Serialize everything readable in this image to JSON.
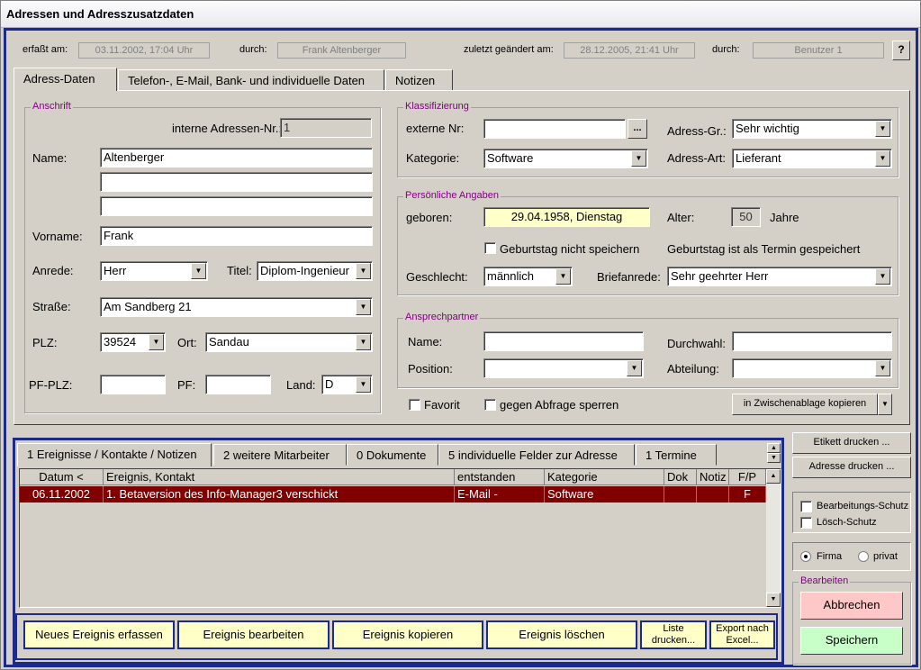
{
  "window_title": "Adressen und Adresszusatzdaten",
  "meta": {
    "erfasst_label": "erfaßt am:",
    "erfasst_value": "03.11.2002, 17:04 Uhr",
    "durch1_label": "durch:",
    "durch1_value": "Frank Altenberger",
    "geaendert_label": "zuletzt geändert am:",
    "geaendert_value": "28.12.2005, 21:41 Uhr",
    "durch2_label": "durch:",
    "durch2_value": "Benutzer 1",
    "help_icon": "help-icon"
  },
  "tabs": [
    "Adress-Daten",
    "Telefon-, E-Mail, Bank- und individuelle Daten",
    "Notizen"
  ],
  "anschrift": {
    "title": "Anschrift",
    "intnr_label": "interne Adressen-Nr.:",
    "intnr_value": "1",
    "name_label": "Name:",
    "name1": "Altenberger",
    "name2": "",
    "name3": "",
    "vorname_label": "Vorname:",
    "vorname": "Frank",
    "anrede_label": "Anrede:",
    "anrede": "Herr",
    "titel_label": "Titel:",
    "titel": "Diplom-Ingenieur",
    "strasse_label": "Straße:",
    "strasse": "Am Sandberg 21",
    "plz_label": "PLZ:",
    "plz": "39524",
    "ort_label": "Ort:",
    "ort": "Sandau",
    "pfplz_label": "PF-PLZ:",
    "pfplz": "",
    "pf_label": "PF:",
    "pf": "",
    "land_label": "Land:",
    "land": "D"
  },
  "klassifizierung": {
    "title": "Klassifizierung",
    "extnr_label": "externe Nr:",
    "extnr": "",
    "ellipsis": "...",
    "adressgr_label": "Adress-Gr.:",
    "adressgr": "Sehr wichtig",
    "kategorie_label": "Kategorie:",
    "kategorie": "Software",
    "adressart_label": "Adress-Art:",
    "adressart": "Lieferant"
  },
  "persoenlich": {
    "title": "Persönliche Angaben",
    "geboren_label": "geboren:",
    "geboren": "29.04.1958, Dienstag",
    "alter_label": "Alter:",
    "alter": "50",
    "jahre": "Jahre",
    "geb_nicht_speichern": "Geburtstag nicht speichern",
    "geb_termin": "Geburtstag ist als Termin gespeichert",
    "geschlecht_label": "Geschlecht:",
    "geschlecht": "männlich",
    "briefanrede_label": "Briefanrede:",
    "briefanrede": "Sehr geehrter Herr"
  },
  "ansprechpartner": {
    "title": "Ansprechpartner",
    "name_label": "Name:",
    "name": "",
    "durchwahl_label": "Durchwahl:",
    "durchwahl": "",
    "position_label": "Position:",
    "position": "",
    "abteilung_label": "Abteilung:",
    "abteilung": ""
  },
  "favorit_label": "Favorit",
  "sperren_label": "gegen Abfrage sperren",
  "zwischenablage_label": "in Zwischenablage kopieren",
  "lower_tabs": [
    "1 Ereignisse / Kontakte / Notizen",
    "2 weitere Mitarbeiter",
    "0 Dokumente",
    "5 individuelle Felder zur Adresse",
    "1 Termine"
  ],
  "table": {
    "headers": [
      "Datum  <",
      "Ereignis, Kontakt",
      "entstanden",
      "Kategorie",
      "Dok",
      "Notiz",
      "F/P"
    ],
    "rows": [
      [
        "06.11.2002",
        "1. Betaversion des Info-Manager3 verschickt",
        "E-Mail -",
        "Software",
        "",
        "",
        "F"
      ]
    ]
  },
  "bottom_buttons": [
    "Neues Ereignis erfassen",
    "Ereignis bearbeiten",
    "Ereignis kopieren",
    "Ereignis löschen"
  ],
  "liste_drucken": [
    "Liste",
    "drucken..."
  ],
  "export_excel": [
    "Export nach",
    "Excel..."
  ],
  "side": {
    "etikett": "Etikett drucken ...",
    "adresse": "Adresse drucken ...",
    "bearbeitungsschutz": "Bearbeitungs-Schutz",
    "loeschschutz": "Lösch-Schutz",
    "firma": "Firma",
    "privat": "privat",
    "bearbeiten_title": "Bearbeiten",
    "abbrechen": "Abbrechen",
    "speichern": "Speichern"
  },
  "colors": {
    "accent": "#1c2a8a",
    "selected_row": "#800000",
    "abbrechen_bg": "#ffc8c8",
    "speichern_bg": "#c8ffc8",
    "input_yellow": "#ffffc8"
  }
}
